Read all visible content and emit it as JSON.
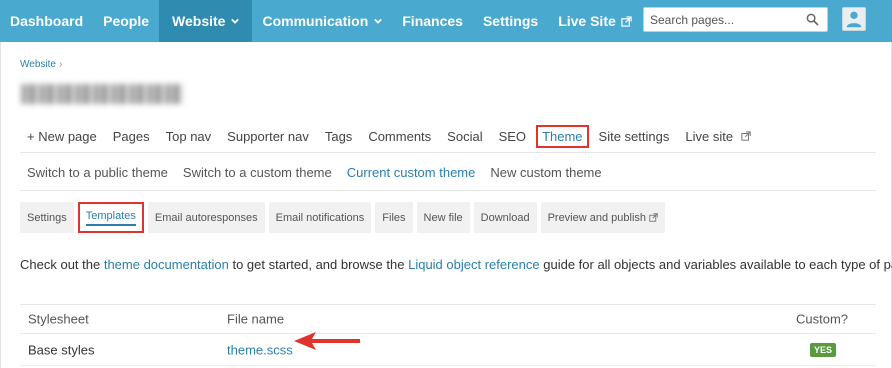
{
  "topnav": {
    "items": [
      {
        "label": "Dashboard"
      },
      {
        "label": "People"
      },
      {
        "label": "Website"
      },
      {
        "label": "Communication"
      },
      {
        "label": "Finances"
      },
      {
        "label": "Settings"
      },
      {
        "label": "Live Site"
      }
    ],
    "active": "Website",
    "search_placeholder": "Search pages...",
    "color": "#4aa9cf",
    "active_color": "#2f8cb0"
  },
  "breadcrumb": {
    "label": "Website"
  },
  "primary_tabs": [
    "+ New page",
    "Pages",
    "Top nav",
    "Supporter nav",
    "Tags",
    "Comments",
    "Social",
    "SEO",
    "Theme",
    "Site settings",
    "Live site"
  ],
  "primary_active": "Theme",
  "theme_tabs": [
    "Switch to a public theme",
    "Switch to a custom theme",
    "Current custom theme",
    "New custom theme"
  ],
  "theme_current": "Current custom theme",
  "sub_tabs": [
    "Settings",
    "Templates",
    "Email autoresponses",
    "Email notifications",
    "Files",
    "New file",
    "Download",
    "Preview and publish"
  ],
  "sub_active": "Templates",
  "description": {
    "part1": "Check out the ",
    "link1": "theme documentation",
    "part2": " to get started, and browse the ",
    "link2": "Liquid object reference",
    "part3": " guide for all objects and variables available to each type of page."
  },
  "table": {
    "headers": [
      "Stylesheet",
      "File name",
      "Custom?"
    ],
    "rows": [
      {
        "stylesheet": "Base styles",
        "file": "theme.scss",
        "custom": "YES"
      }
    ]
  },
  "icons": [
    "chevron-down-icon",
    "external-link-icon",
    "search-icon",
    "user-icon",
    "arrow-icon"
  ],
  "highlight_color": "#e0332b",
  "link_color": "#2a7fab"
}
